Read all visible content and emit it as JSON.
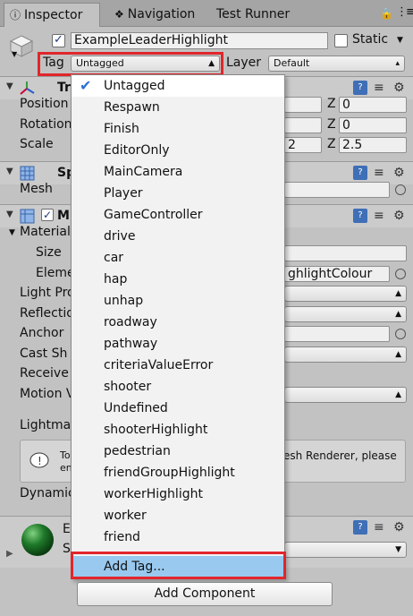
{
  "tabs": [
    {
      "label": "Inspector",
      "icon": "info-icon"
    },
    {
      "label": "Navigation",
      "icon": "navigation-icon"
    },
    {
      "label": "Test Runner"
    }
  ],
  "header": {
    "object_name": "ExampleLeaderHighlight",
    "static_label": "Static",
    "tag_label": "Tag",
    "tag_value": "Untagged",
    "layer_label": "Layer",
    "layer_value": "Default",
    "active_checked": true,
    "static_checked": false
  },
  "transform": {
    "title": "Tr",
    "rows": [
      {
        "label": "Position",
        "z_label": "Z",
        "z_value": "0"
      },
      {
        "label": "Rotation",
        "z_label": "Z",
        "z_value": "0"
      },
      {
        "label": "Scale",
        "y_partial": "2",
        "z_label": "Z",
        "z_value": "2.5"
      }
    ]
  },
  "mesh_filter": {
    "title": "Sp",
    "mesh_label": "Mesh"
  },
  "mesh_renderer": {
    "title": "M",
    "materials_label": "Materials",
    "size_label": "Size",
    "element_label": "Eleme",
    "element_value": "ghlightColour",
    "light_probes_label": "Light Pro",
    "reflection_label": "Reflectio",
    "anchor_label": "Anchor",
    "cast_shadows_label": "Cast Sh",
    "receive_label": "Receive",
    "motion_label": "Motion V",
    "lightmap_label": "Lightma",
    "help_left": "To",
    "help_left2": "en",
    "help_right": "esh Renderer, please",
    "dynamic_label": "Dynamic"
  },
  "material": {
    "title": "E",
    "shader_label": "S"
  },
  "dropdown": {
    "items": [
      {
        "label": "Untagged",
        "selected": true
      },
      {
        "label": "Respawn"
      },
      {
        "label": "Finish"
      },
      {
        "label": "EditorOnly"
      },
      {
        "label": "MainCamera"
      },
      {
        "label": "Player"
      },
      {
        "label": "GameController"
      },
      {
        "label": "drive"
      },
      {
        "label": "car"
      },
      {
        "label": "hap"
      },
      {
        "label": "unhap"
      },
      {
        "label": "roadway"
      },
      {
        "label": "pathway"
      },
      {
        "label": "criteriaValueError"
      },
      {
        "label": "shooter"
      },
      {
        "label": "Undefined"
      },
      {
        "label": "shooterHighlight"
      },
      {
        "label": "pedestrian"
      },
      {
        "label": "friendGroupHighlight"
      },
      {
        "label": "workerHighlight"
      },
      {
        "label": "worker"
      },
      {
        "label": "friend"
      }
    ],
    "add_tag": "Add Tag..."
  },
  "add_component": "Add Component",
  "colors": {
    "highlight": "#e0262b",
    "menu_hover": "#99c9ef",
    "check": "#2a6fd6"
  }
}
